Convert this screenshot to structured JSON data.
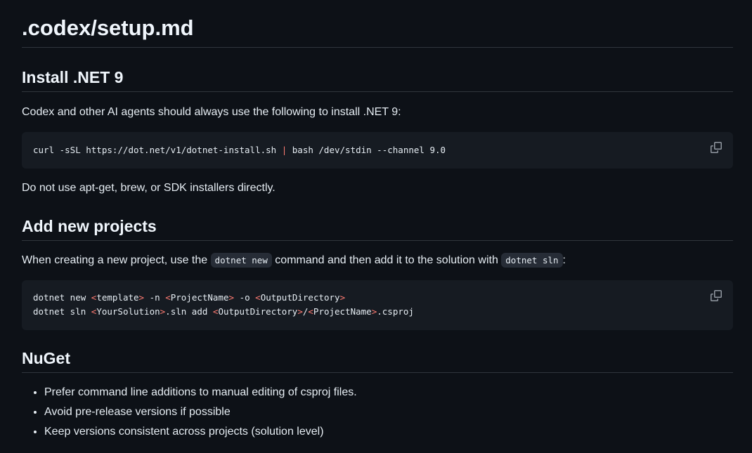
{
  "title": ".codex/setup.md",
  "install": {
    "heading": "Install .NET 9",
    "intro": "Codex and other AI agents should always use the following to install .NET 9:",
    "code": {
      "cmd_before": "curl -sSL https://dot.net/v1/dotnet-install.sh ",
      "pipe": "|",
      "cmd_after": " bash /dev/stdin --channel 9.0"
    },
    "note": "Do not use apt-get, brew, or SDK installers directly."
  },
  "add_projects": {
    "heading": "Add new projects",
    "intro_part1": "When creating a new project, use the ",
    "inline_code1": "dotnet new",
    "intro_part2": " command and then add it to the solution with ",
    "inline_code2": "dotnet sln",
    "intro_part3": ":",
    "code": {
      "line1_a": "dotnet new ",
      "line1_b": "template",
      "line1_c": " -n ",
      "line1_d": "ProjectName",
      "line1_e": " -o ",
      "line1_f": "OutputDirectory",
      "line2_a": "dotnet sln ",
      "line2_b": "YourSolution",
      "line2_c": ".sln add ",
      "line2_d": "OutputDirectory",
      "line2_e": "/",
      "line2_f": "ProjectName",
      "line2_g": ".csproj"
    }
  },
  "nuget": {
    "heading": "NuGet",
    "items": [
      "Prefer command line additions to manual editing of csproj files.",
      "Avoid pre-release versions if possible",
      "Keep versions consistent across projects (solution level)"
    ]
  },
  "colors": {
    "background": "#0d1117",
    "code_background": "#161b22",
    "text": "#e6edf3",
    "operator": "#ff7b72",
    "border": "#30363d"
  },
  "icons": {
    "copy": "copy-icon"
  }
}
